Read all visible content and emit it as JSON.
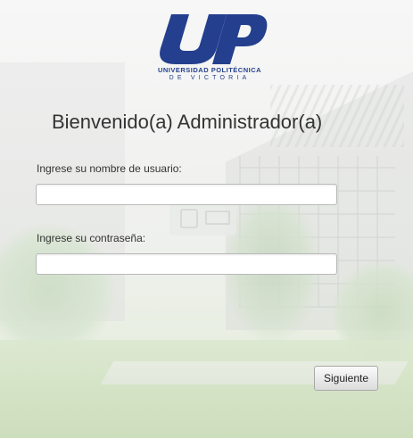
{
  "logo": {
    "initials": "UP",
    "line1": "UNIVERSIDAD POLITÉCNICA",
    "line2": "DE VICTORIA",
    "color": "#243f8e"
  },
  "title": "Bienvenido(a) Administrador(a)",
  "form": {
    "username_label": "Ingrese su nombre de usuario:",
    "username_value": "",
    "password_label": "Ingrese su contraseña:",
    "password_value": "",
    "submit_label": "Siguiente"
  }
}
